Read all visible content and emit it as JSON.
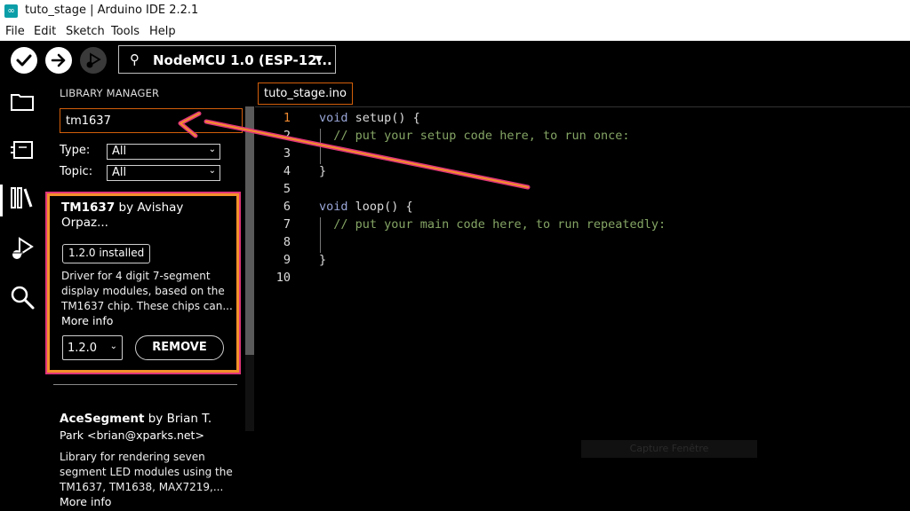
{
  "window": {
    "title": "tuto_stage | Arduino IDE 2.2.1"
  },
  "menu": [
    "File",
    "Edit",
    "Sketch",
    "Tools",
    "Help"
  ],
  "toolbar": {
    "board": "NodeMCU 1.0 (ESP-12..."
  },
  "library_manager": {
    "title": "LIBRARY MANAGER",
    "search_value": "tm1637",
    "type_label": "Type:",
    "type_value": "All",
    "topic_label": "Topic:",
    "topic_value": "All",
    "results": [
      {
        "name": "TM1637",
        "author_line1": " by Avishay",
        "author_line2": "Orpaz...",
        "installed_badge": "1.2.0 installed",
        "desc_lines": [
          "Driver for 4 digit 7-segment",
          "display modules, based on the",
          "TM1637 chip. These chips can..."
        ],
        "more_info": "More info",
        "version": "1.2.0",
        "action": "REMOVE"
      },
      {
        "name": "AceSegment",
        "author_line1": " by Brian T.",
        "author_line2": "Park <brian@xparks.net>",
        "desc_lines": [
          "Library for rendering seven",
          "segment LED modules using the",
          "TM1637, TM1638, MAX7219,..."
        ],
        "more_info": "More info"
      }
    ]
  },
  "editor": {
    "tab": "tuto_stage.ino",
    "current_line": 1,
    "line_numbers": [
      "1",
      "2",
      "3",
      "4",
      "5",
      "6",
      "7",
      "8",
      "9",
      "10"
    ],
    "lines": [
      {
        "kw": "void",
        "rest": " setup() {"
      },
      {
        "cmt": "  // put your setup code here, to run once:"
      },
      {
        "text": ""
      },
      {
        "text": "}"
      },
      {
        "text": ""
      },
      {
        "kw": "void",
        "rest": " loop() {"
      },
      {
        "cmt": "  // put your main code here, to run repeatedly:"
      },
      {
        "text": ""
      },
      {
        "text": "}"
      },
      {
        "text": ""
      }
    ]
  },
  "overlay_text": "Capture Fenêtre",
  "colors": {
    "accent_orange": "#d35f0a",
    "annotation_arrow": "#f2902a",
    "annotation_pink": "#e0357a",
    "keyword": "#9aa7d8",
    "comment": "#85a565"
  },
  "icons": [
    "verify-icon",
    "upload-icon",
    "debug-icon",
    "usb-icon",
    "folder-icon",
    "board-icon",
    "library-icon",
    "debug-panel-icon",
    "search-icon"
  ]
}
